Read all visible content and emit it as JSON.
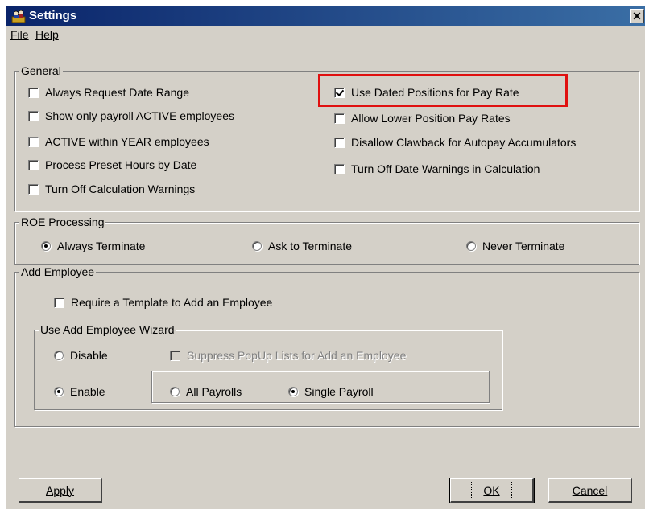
{
  "window": {
    "title": "Settings",
    "close_label": "✕"
  },
  "menu": {
    "file": "File",
    "help": "Help"
  },
  "general": {
    "label": "General",
    "left": [
      {
        "label": "Always Request Date Range",
        "checked": false
      },
      {
        "label": "Show only payroll ACTIVE employees",
        "checked": false
      },
      {
        "label": "ACTIVE within YEAR employees",
        "checked": false
      },
      {
        "label": "Process Preset Hours by Date",
        "checked": false
      },
      {
        "label": "Turn Off Calculation Warnings",
        "checked": false
      }
    ],
    "right": [
      {
        "label": "Use Dated Positions for Pay Rate",
        "checked": true
      },
      {
        "label": "Allow Lower Position Pay Rates",
        "checked": false
      },
      {
        "label": "Disallow Clawback for Autopay Accumulators",
        "checked": false
      },
      {
        "label": "Turn Off Date Warnings in Calculation",
        "checked": false
      }
    ]
  },
  "roe": {
    "label": "ROE Processing",
    "options": [
      {
        "label": "Always Terminate",
        "selected": true
      },
      {
        "label": "Ask to Terminate",
        "selected": false
      },
      {
        "label": "Never Terminate",
        "selected": false
      }
    ]
  },
  "add_employee": {
    "label": "Add Employee",
    "require_template": {
      "label": "Require a Template to Add an Employee",
      "checked": false
    },
    "wizard": {
      "label": "Use Add Employee Wizard",
      "disable": {
        "label": "Disable",
        "selected": false
      },
      "enable": {
        "label": "Enable",
        "selected": true
      },
      "suppress": {
        "label": "Suppress PopUp Lists for Add an Employee",
        "checked": false,
        "disabled": true
      },
      "all_payrolls": {
        "label": "All Payrolls",
        "selected": false
      },
      "single_payroll": {
        "label": "Single Payroll",
        "selected": true
      }
    }
  },
  "buttons": {
    "apply": "Apply",
    "ok": "OK",
    "cancel": "Cancel"
  },
  "colors": {
    "title_start": "#0a246a",
    "title_end": "#3a6ea5",
    "face": "#d4d0c8",
    "highlight": "#e01010"
  }
}
